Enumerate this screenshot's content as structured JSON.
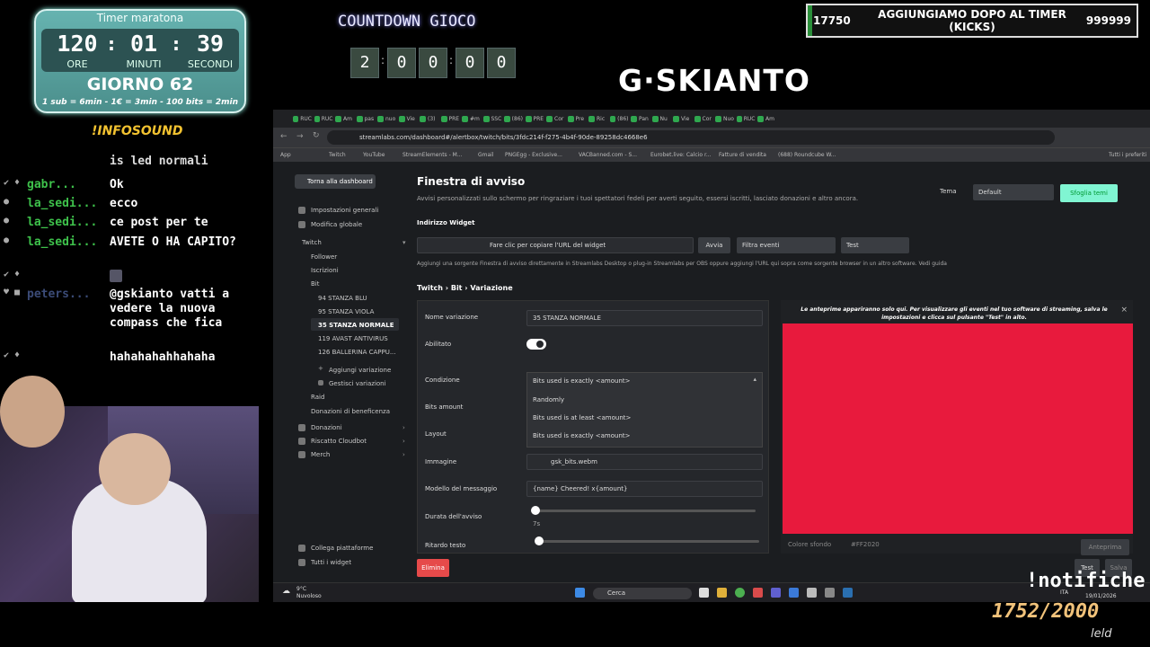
{
  "timer": {
    "title": "Timer maratona",
    "hours": "120",
    "minutes": "01",
    "seconds": "39",
    "hours_label": "ORE",
    "minutes_label": "MINUTI",
    "seconds_label": "SECONDI",
    "day": "GIORNO 62",
    "rates": "1 sub = 6min - 1€ = 3min - 100 bits = 2min"
  },
  "infosound": "!INFOSOUND",
  "chat": [
    {
      "user": "",
      "msg": "is led normali"
    },
    {
      "user": "gabr...",
      "msg": "Ok"
    },
    {
      "user": "la_sedi...",
      "msg": "ecco"
    },
    {
      "user": "la_sedi...",
      "msg": "ce post per te"
    },
    {
      "user": "la_sedi...",
      "msg": "AVETE O HA CAPITO?"
    },
    {
      "user": "",
      "msg": ""
    },
    {
      "user": "peters...",
      "msg": "@gskianto vatti a vedere la nuova compass che fica"
    },
    {
      "user": "",
      "msg": "hahahahahhahaha"
    }
  ],
  "countdown": {
    "title": "COUNTDOWN GIOCO",
    "digits": [
      "2",
      "0",
      "0",
      "0",
      "0"
    ]
  },
  "logo": "G·SKIANTO",
  "goal": {
    "current": "17750",
    "text": "AGGIUNGIAMO DOPO AL TIMER (KICKS)",
    "target": "999999"
  },
  "browser": {
    "tabs": [
      "RUC",
      "RUC",
      "Am",
      "pas",
      "nuo",
      "Vie",
      "(3)",
      "PRE",
      "#m",
      "SSC",
      "(86)",
      "PRE",
      "Cor",
      "Pre",
      "Ric",
      "(86)",
      "Pan",
      "Nu",
      "Vie",
      "Cor",
      "Nuo",
      "RUC",
      "Am"
    ],
    "url": "streamlabs.com/dashboard#/alertbox/twitch/bits/3fdc214f-f275-4b4f-90de-89258dc4668e6",
    "bookmarks": [
      "App",
      "Twitch",
      "YouTube",
      "StreamElements - M...",
      "Gmail",
      "PNGEgg - Exclusive...",
      "VACBanned.com - S...",
      "Eurobet.live: Calcio r...",
      "Fatture di vendita",
      "(688) Roundcube W...",
      "Tutti i preferiti"
    ]
  },
  "sidebar": {
    "back": "Torna alla dashboard",
    "items": {
      "impostazioni": "Impostazioni generali",
      "modifica": "Modifica globale",
      "twitch": "Twitch",
      "follower": "Follower",
      "iscrizioni": "Iscrizioni",
      "bit": "Bit",
      "v1": "94 STANZA BLU",
      "v2": "95 STANZA VIOLA",
      "v3": "35 STANZA NORMALE",
      "v4": "119 AVAST ANTIVIRUS",
      "v5": "126 BALLERINA CAPPU...",
      "aggiungi": "Aggiungi variazione",
      "gestisci": "Gestisci variazioni",
      "raid": "Raid",
      "donazioni_benef": "Donazioni di beneficenza",
      "donazioni": "Donazioni",
      "riscatto": "Riscatto Cloudbot",
      "merch": "Merch",
      "collega": "Collega piattaforme",
      "tutti": "Tutti i widget"
    }
  },
  "main": {
    "title": "Finestra di avviso",
    "subtitle": "Avvisi personalizzati sullo schermo per ringraziare i tuoi spettatori fedeli per averti seguito, essersi iscritti, lasciato donazioni e altro ancora.",
    "tema_label": "Tema",
    "tema_value": "Default",
    "sfoglia": "Sfoglia temi",
    "widget_label": "Indirizzo Widget",
    "widget_copy": "Fare clic per copiare l'URL del widget",
    "avvia": "Avvia",
    "filtra": "Filtra eventi",
    "test": "Test",
    "hint": "Aggiungi una sorgente Finestra di avviso direttamente in Streamlabs Desktop o plug-in Streamlabs per OBS oppure aggiungi l'URL qui sopra come sorgente browser in un altro software. Vedi guida",
    "breadcrumb": "Twitch › Bit › Variazione",
    "nome_label": "Nome variazione",
    "nome_value": "35 STANZA NORMALE",
    "abilitato": "Abilitato",
    "condizione": "Condizione",
    "condizione_value": "Bits used is exactly <amount>",
    "options": [
      "Randomly",
      "Bits used is at least <amount>",
      "Bits used is exactly <amount>"
    ],
    "bits_amount": "Bits amount",
    "layout": "Layout",
    "immagine": "Immagine",
    "immagine_value": "gsk_bits.webm",
    "modello": "Modello del messaggio",
    "modello_value": "{name} Cheered! x{amount}",
    "durata": "Durata dell'avviso",
    "durata_value": "7s",
    "ritardo": "Ritardo testo",
    "durata_fraction": 0.0,
    "ritardo_fraction": 0.0,
    "preview_note": "Le anteprime appariranno solo qui. Per visualizzare gli eventi nel tuo software di streaming, salva le impostazioni e clicca sul pulsante \"Test\" in alto.",
    "colore_label": "Colore sfondo",
    "colore_value": "#FF2020",
    "anteprima": "Anteprima",
    "elimina": "Elimina",
    "test_bottom": "Test",
    "salva": "Salva",
    "preview_color": "#e81a3d"
  },
  "taskbar": {
    "weather_temp": "9°C",
    "weather_text": "Nuvoloso",
    "search": "Cerca",
    "lang": "ITA",
    "time": "...",
    "date": "19/01/2026"
  },
  "overlay": {
    "notifiche": "!notifiche",
    "counter": "1752/2000",
    "name": "leld"
  }
}
